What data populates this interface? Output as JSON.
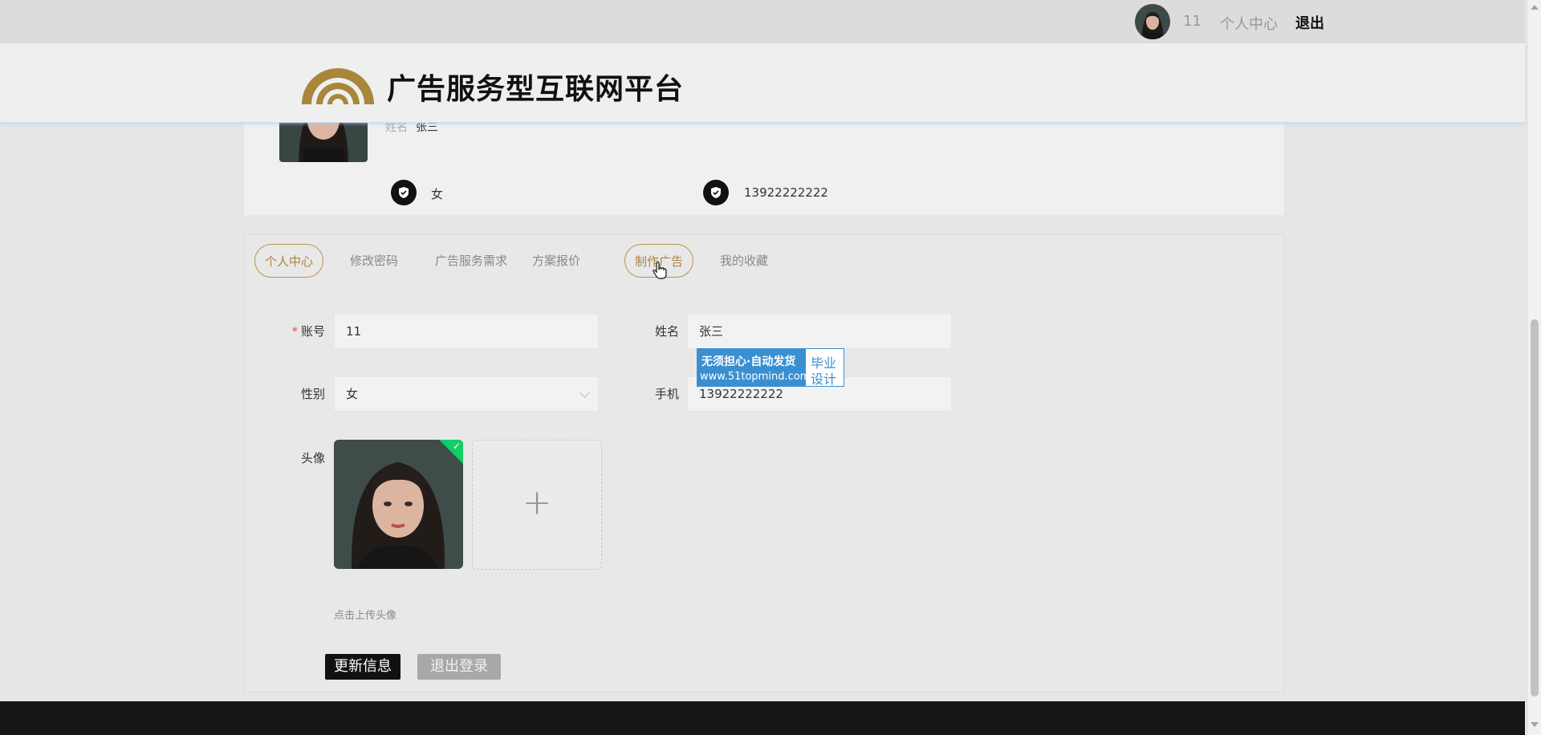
{
  "topbar": {
    "user_id": "11",
    "center_link": "个人中心",
    "logout_link": "退出"
  },
  "header": {
    "title": "广告服务型互联网平台"
  },
  "profile": {
    "name_label": "姓名",
    "name_value": "张三",
    "gender": "女",
    "phone": "13922222222"
  },
  "tabs": [
    {
      "label": "个人中心",
      "active": true
    },
    {
      "label": "修改密码"
    },
    {
      "label": "广告服务需求"
    },
    {
      "label": "方案报价"
    },
    {
      "label": "制作广告",
      "hovered": true
    },
    {
      "label": "我的收藏"
    }
  ],
  "form": {
    "account_label": "账号",
    "account_required": "*",
    "account_value": "11",
    "name_label": "姓名",
    "name_value": "张三",
    "gender_label": "性别",
    "gender_value": "女",
    "phone_label": "手机",
    "phone_value": "13922222222",
    "avatar_label": "头像",
    "upload_hint": "点击上传头像",
    "update_button": "更新信息",
    "logout_button": "退出登录"
  },
  "watermark": {
    "line1": "无须担心·自动发货",
    "line2": "www.51topmind.com",
    "right1": "毕业",
    "right2": "设计"
  },
  "colors": {
    "accent_gold": "#b8944a",
    "primary_black": "#111111",
    "success_green": "#13ce66",
    "watermark_blue": "#3a8fd0"
  }
}
